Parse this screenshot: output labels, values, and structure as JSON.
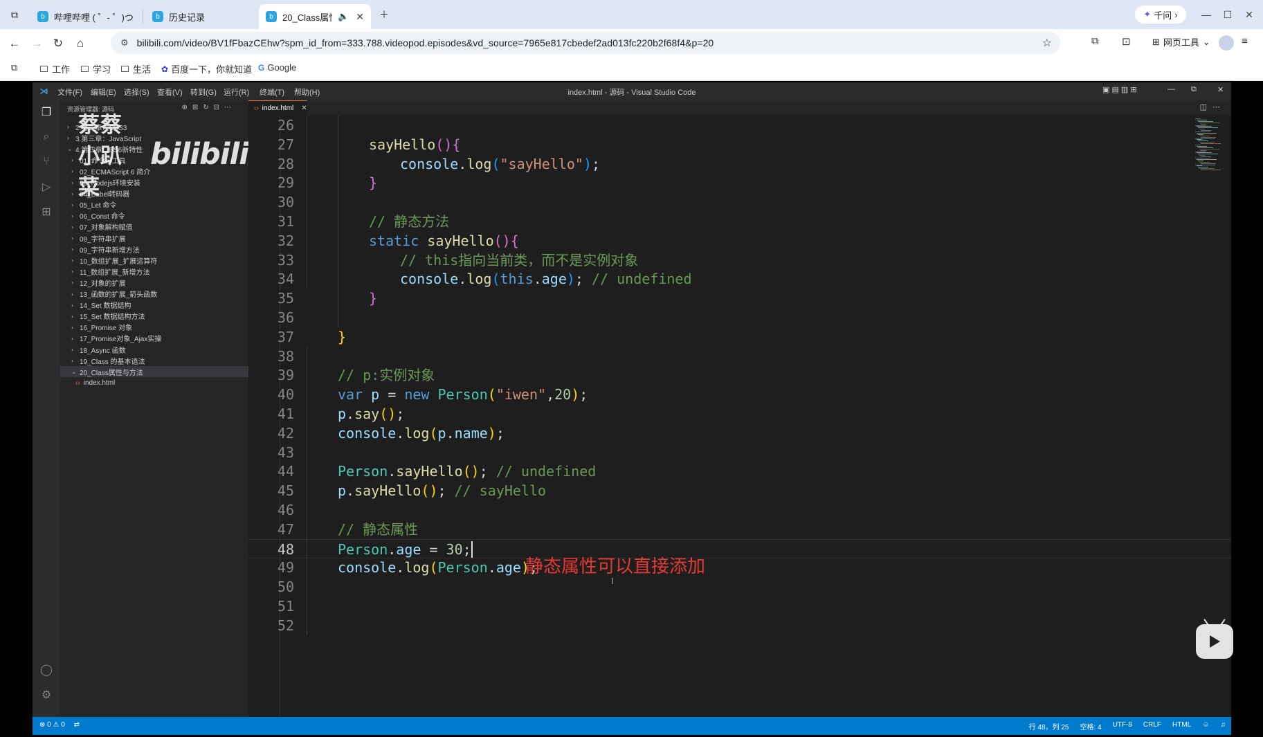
{
  "browser": {
    "tabs": [
      {
        "label": "哔哩哔哩 ( ゜- ゜)つロ",
        "active": false
      },
      {
        "label": "历史记录",
        "active": false
      },
      {
        "label": "20_Class属性",
        "active": true
      }
    ],
    "qianwen_label": "千问",
    "url": "bilibili.com/video/BV1fFbazCEhw?spm_id_from=333.788.videopod.episodes&vd_source=7965e817cbedef2ad013fc220b2f68f4&p=20",
    "web_tools_label": "网页工具",
    "bookmarks": [
      "工作",
      "学习",
      "生活",
      "百度一下，你就知道",
      "Google"
    ]
  },
  "vscode": {
    "menu": [
      "文件(F)",
      "编辑(E)",
      "选择(S)",
      "查看(V)",
      "转到(G)",
      "运行(R)",
      "终端(T)",
      "帮助(H)"
    ],
    "window_title": "index.html - 源码 - Visual Studio Code",
    "explorer_title": "资源管理器: 源码",
    "watermark_text": "蔡蔡小趴菜",
    "watermark_logo": "bilibili",
    "tree": [
      {
        "label": "2.第二章：CSS3",
        "chevron": "›",
        "level": 1,
        "selected": false
      },
      {
        "label": "3.第三章：JavaScript",
        "chevron": "›",
        "level": 1,
        "selected": false
      },
      {
        "label": "4.第四章：ES6新特性",
        "chevron": "⌄",
        "level": 1,
        "selected": false
      },
      {
        "label": "01_命令行工具",
        "chevron": "›",
        "level": 2,
        "selected": false
      },
      {
        "label": "02_ECMAScript 6 简介",
        "chevron": "›",
        "level": 2,
        "selected": false
      },
      {
        "label": "03_Nodejs环境安装",
        "chevron": "›",
        "level": 2,
        "selected": false
      },
      {
        "label": "04_Babel转码器",
        "chevron": "›",
        "level": 2,
        "selected": false
      },
      {
        "label": "05_Let 命令",
        "chevron": "›",
        "level": 2,
        "selected": false
      },
      {
        "label": "06_Const 命令",
        "chevron": "›",
        "level": 2,
        "selected": false
      },
      {
        "label": "07_对象解构赋值",
        "chevron": "›",
        "level": 2,
        "selected": false
      },
      {
        "label": "08_字符串扩展",
        "chevron": "›",
        "level": 2,
        "selected": false
      },
      {
        "label": "09_字符串新增方法",
        "chevron": "›",
        "level": 2,
        "selected": false
      },
      {
        "label": "10_数组扩展_扩展运算符",
        "chevron": "›",
        "level": 2,
        "selected": false
      },
      {
        "label": "11_数组扩展_新增方法",
        "chevron": "›",
        "level": 2,
        "selected": false
      },
      {
        "label": "12_对象的扩展",
        "chevron": "›",
        "level": 2,
        "selected": false
      },
      {
        "label": "13_函数的扩展_箭头函数",
        "chevron": "›",
        "level": 2,
        "selected": false
      },
      {
        "label": "14_Set 数据结构",
        "chevron": "›",
        "level": 2,
        "selected": false
      },
      {
        "label": "15_Set 数据结构方法",
        "chevron": "›",
        "level": 2,
        "selected": false
      },
      {
        "label": "16_Promise 对象",
        "chevron": "›",
        "level": 2,
        "selected": false
      },
      {
        "label": "17_Promise对象_Ajax实操",
        "chevron": "›",
        "level": 2,
        "selected": false
      },
      {
        "label": "18_Async 函数",
        "chevron": "›",
        "level": 2,
        "selected": false
      },
      {
        "label": "19_Class 的基本语法",
        "chevron": "›",
        "level": 2,
        "selected": false
      },
      {
        "label": "20_Class属性与方法",
        "chevron": "⌄",
        "level": 2,
        "selected": true
      },
      {
        "label": "index.html",
        "chevron": "",
        "level": 3,
        "selected": false,
        "file": true
      }
    ],
    "editor_tab": "index.html",
    "current_line": 48,
    "code_lines": [
      {
        "n": 26,
        "tokens": []
      },
      {
        "n": 27,
        "indent": 2,
        "tokens": [
          [
            "sayHello",
            "fn"
          ],
          [
            "()",
            "br2"
          ],
          [
            "{",
            "br2"
          ]
        ]
      },
      {
        "n": 28,
        "indent": 3,
        "tokens": [
          [
            "console",
            "var"
          ],
          [
            ".",
            "plain"
          ],
          [
            "log",
            "fn"
          ],
          [
            "(",
            "br3"
          ],
          [
            "\"sayHello\"",
            "str"
          ],
          [
            ")",
            "br3"
          ],
          [
            ";",
            "plain"
          ]
        ]
      },
      {
        "n": 29,
        "indent": 2,
        "tokens": [
          [
            "}",
            "br2"
          ]
        ]
      },
      {
        "n": 30,
        "tokens": []
      },
      {
        "n": 31,
        "indent": 2,
        "tokens": [
          [
            "// 静态方法",
            "cmt"
          ]
        ]
      },
      {
        "n": 32,
        "indent": 2,
        "tokens": [
          [
            "static",
            "kw"
          ],
          [
            " ",
            "plain"
          ],
          [
            "sayHello",
            "fn"
          ],
          [
            "()",
            "br2"
          ],
          [
            "{",
            "br2"
          ]
        ]
      },
      {
        "n": 33,
        "indent": 3,
        "tokens": [
          [
            "// this指向当前类，而不是实例对象",
            "cmt"
          ]
        ]
      },
      {
        "n": 34,
        "indent": 3,
        "tokens": [
          [
            "console",
            "var"
          ],
          [
            ".",
            "plain"
          ],
          [
            "log",
            "fn"
          ],
          [
            "(",
            "br3"
          ],
          [
            "this",
            "kw"
          ],
          [
            ".",
            "plain"
          ],
          [
            "age",
            "var"
          ],
          [
            ")",
            "br3"
          ],
          [
            "; ",
            "plain"
          ],
          [
            "// undefined",
            "cmt"
          ]
        ]
      },
      {
        "n": 35,
        "indent": 2,
        "tokens": [
          [
            "}",
            "br2"
          ]
        ]
      },
      {
        "n": 36,
        "tokens": []
      },
      {
        "n": 37,
        "indent": 1,
        "tokens": [
          [
            "}",
            "br1"
          ]
        ]
      },
      {
        "n": 38,
        "tokens": []
      },
      {
        "n": 39,
        "indent": 1,
        "tokens": [
          [
            "// p:实例对象",
            "cmt"
          ]
        ]
      },
      {
        "n": 40,
        "indent": 1,
        "tokens": [
          [
            "var",
            "kw"
          ],
          [
            " ",
            "plain"
          ],
          [
            "p",
            "var"
          ],
          [
            " = ",
            "plain"
          ],
          [
            "new",
            "kw"
          ],
          [
            " ",
            "plain"
          ],
          [
            "Person",
            "cls"
          ],
          [
            "(",
            "br1"
          ],
          [
            "\"iwen\"",
            "str"
          ],
          [
            ",",
            "plain"
          ],
          [
            "20",
            "num"
          ],
          [
            ")",
            "br1"
          ],
          [
            ";",
            "plain"
          ]
        ]
      },
      {
        "n": 41,
        "indent": 1,
        "tokens": [
          [
            "p",
            "var"
          ],
          [
            ".",
            "plain"
          ],
          [
            "say",
            "fn"
          ],
          [
            "()",
            "br1"
          ],
          [
            ";",
            "plain"
          ]
        ]
      },
      {
        "n": 42,
        "indent": 1,
        "tokens": [
          [
            "console",
            "var"
          ],
          [
            ".",
            "plain"
          ],
          [
            "log",
            "fn"
          ],
          [
            "(",
            "br1"
          ],
          [
            "p",
            "var"
          ],
          [
            ".",
            "plain"
          ],
          [
            "name",
            "var"
          ],
          [
            ")",
            "br1"
          ],
          [
            ";",
            "plain"
          ]
        ]
      },
      {
        "n": 43,
        "tokens": []
      },
      {
        "n": 44,
        "indent": 1,
        "tokens": [
          [
            "Person",
            "cls"
          ],
          [
            ".",
            "plain"
          ],
          [
            "sayHello",
            "fn"
          ],
          [
            "()",
            "br1"
          ],
          [
            "; ",
            "plain"
          ],
          [
            "// undefined",
            "cmt"
          ]
        ]
      },
      {
        "n": 45,
        "indent": 1,
        "tokens": [
          [
            "p",
            "var"
          ],
          [
            ".",
            "plain"
          ],
          [
            "sayHello",
            "fn"
          ],
          [
            "()",
            "br1"
          ],
          [
            "; ",
            "plain"
          ],
          [
            "// sayHello",
            "cmt"
          ]
        ]
      },
      {
        "n": 46,
        "tokens": []
      },
      {
        "n": 47,
        "indent": 1,
        "tokens": [
          [
            "// 静态属性",
            "cmt"
          ]
        ]
      },
      {
        "n": 48,
        "indent": 1,
        "caret": true,
        "tokens": [
          [
            "Person",
            "cls"
          ],
          [
            ".",
            "plain"
          ],
          [
            "age",
            "var"
          ],
          [
            " = ",
            "plain"
          ],
          [
            "30",
            "num"
          ],
          [
            ";",
            "plain"
          ]
        ]
      },
      {
        "n": 49,
        "indent": 1,
        "tokens": [
          [
            "console",
            "var"
          ],
          [
            ".",
            "plain"
          ],
          [
            "log",
            "fn"
          ],
          [
            "(",
            "br1"
          ],
          [
            "Person",
            "cls"
          ],
          [
            ".",
            "plain"
          ],
          [
            "age",
            "var"
          ],
          [
            ")",
            "br1"
          ],
          [
            ";",
            "plain"
          ]
        ]
      },
      {
        "n": 50,
        "tokens": []
      },
      {
        "n": 51,
        "tokens": []
      },
      {
        "n": 52,
        "tokens": []
      }
    ],
    "annotation": "静态属性可以直接添加",
    "status": {
      "errors": "0",
      "warnings": "0",
      "position": "行 48，列 25",
      "spaces": "空格: 4",
      "encoding": "UTF-8",
      "eol": "CRLF",
      "language": "HTML"
    },
    "syntax_colors": {
      "kw": "#569cd6",
      "fn": "#dcdcaa",
      "var": "#9cdcfe",
      "cls": "#4ec9b0",
      "str": "#ce9178",
      "num": "#b5cea8",
      "cmt": "#6a9955",
      "plain": "#d4d4d4",
      "br1": "#ffd700",
      "br2": "#da70d6",
      "br3": "#179fff"
    }
  }
}
